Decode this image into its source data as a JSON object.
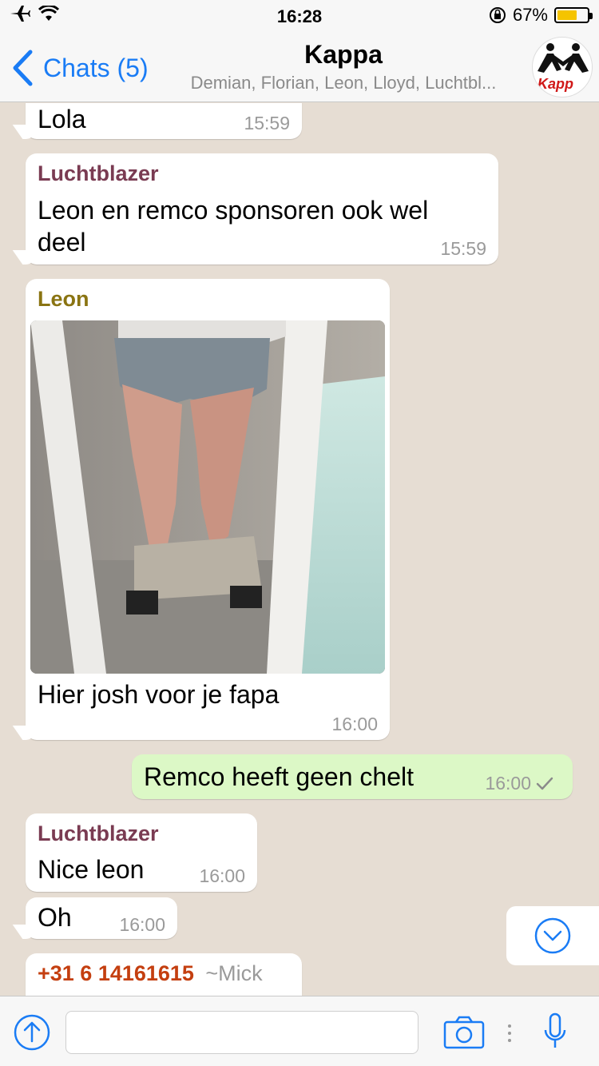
{
  "status_bar": {
    "time": "16:28",
    "battery_percent": "67%",
    "battery_level": 0.67
  },
  "nav": {
    "back_label": "Chats (5)",
    "title": "Kappa",
    "subtitle": "Demian, Florian, Leon, Lloyd, Luchtbl..."
  },
  "messages": [
    {
      "text": "Lola",
      "time": "15:59"
    },
    {
      "sender": "Luchtblazer",
      "text": "Leon en remco sponsoren ook wel deel",
      "time": "15:59"
    },
    {
      "sender": "Leon",
      "text": "Hier josh voor je fapa",
      "time": "16:00"
    },
    {
      "text": "Remco heeft geen chelt",
      "time": "16:00"
    },
    {
      "sender": "Luchtblazer",
      "text": "Nice leon",
      "time": "16:00"
    },
    {
      "text": "Oh",
      "time": "16:00"
    },
    {
      "sender": "+31 6 14161615",
      "sender_alias": "~Mick"
    }
  ],
  "colors": {
    "accent": "#1a7cf5",
    "sender_luchtblazer": "#7a3b52",
    "sender_leon": "#8a7412",
    "sender_mick": "#c43f10",
    "outgoing_bubble": "#dcf8c6",
    "read_check": "#8a8a8a"
  },
  "icons": {
    "back": "chevron-left-icon",
    "upload": "arrow-up-circle-icon",
    "camera": "camera-icon",
    "mic": "microphone-icon",
    "scroll_down": "chevron-down-circle-icon"
  }
}
